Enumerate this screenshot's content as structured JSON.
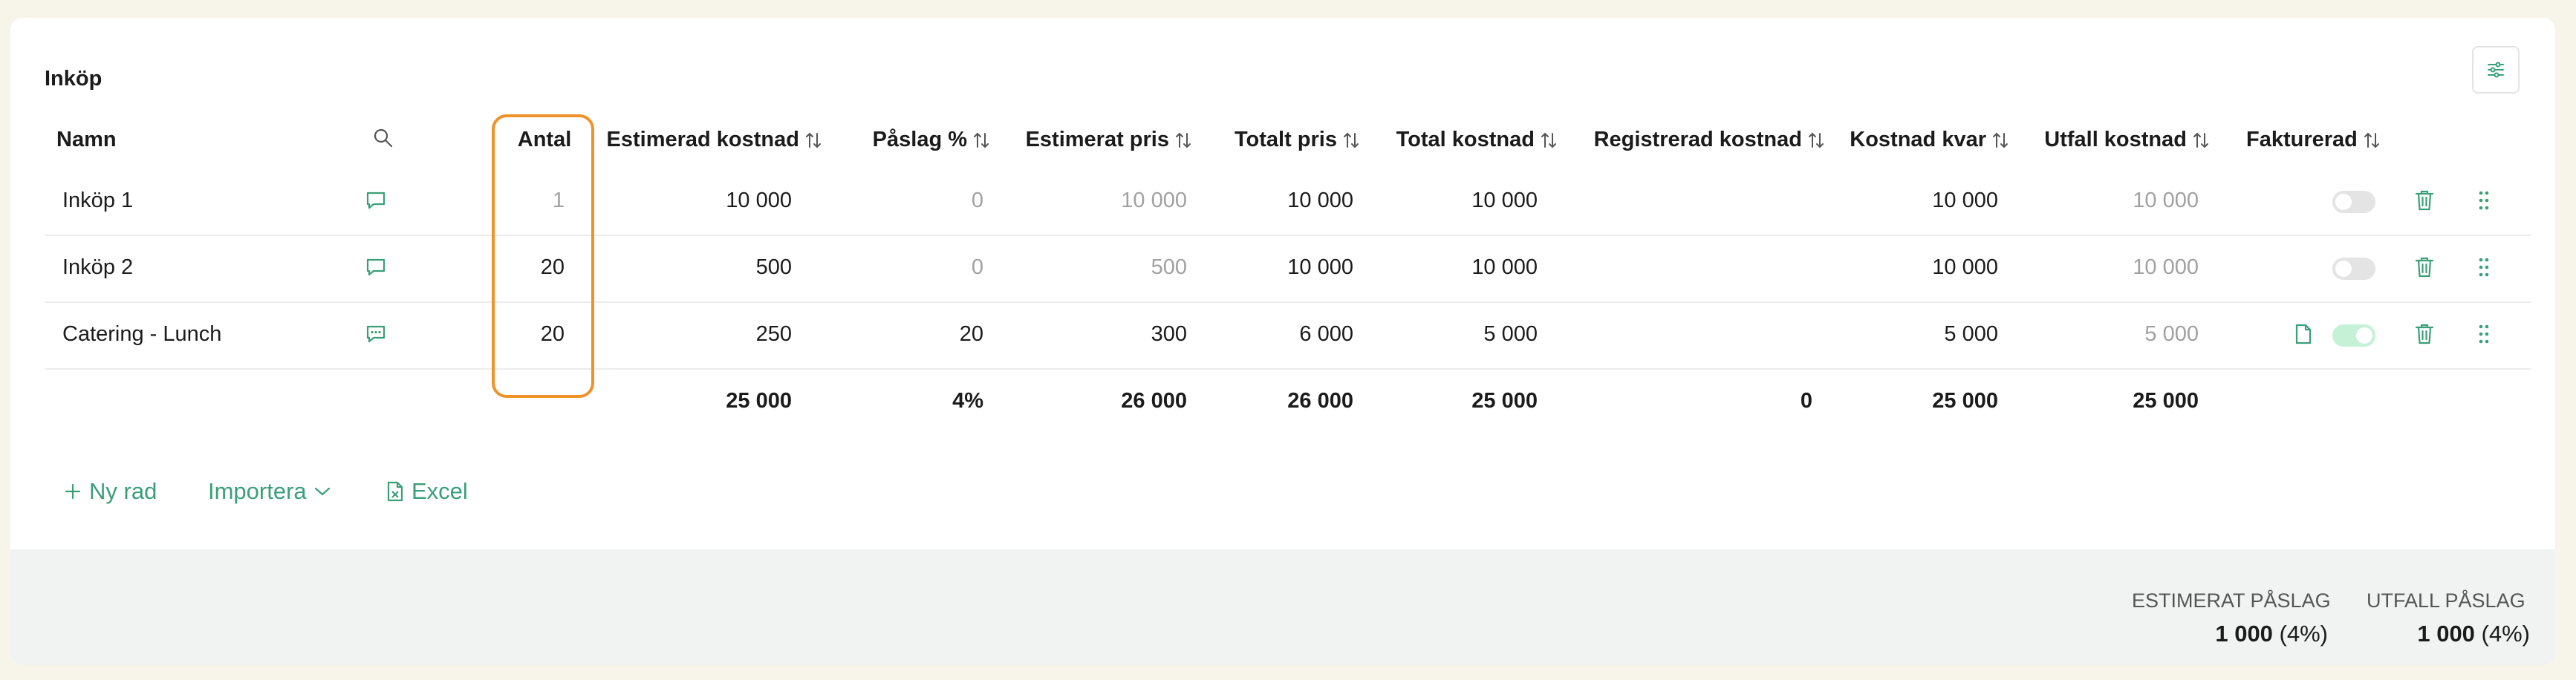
{
  "section": {
    "title": "Inköp"
  },
  "columns": {
    "name": "Namn",
    "qty": "Antal",
    "est_cost": "Estimerad kostnad",
    "markup": "Påslag %",
    "est_price": "Estimerat pris",
    "total_price": "Totalt pris",
    "total_cost": "Total kostnad",
    "reg_cost": "Registrerad kostnad",
    "cost_left": "Kostnad kvar",
    "outcome_cost": "Utfall kostnad",
    "invoiced": "Fakturerad"
  },
  "rows": [
    {
      "name": "Inköp 1",
      "qty": "1",
      "est_cost": "10 000",
      "markup": "0",
      "est_price": "10 000",
      "total_price": "10 000",
      "total_cost": "10 000",
      "reg_cost": "",
      "cost_left": "10 000",
      "outcome_cost": "10 000",
      "invoiced": false
    },
    {
      "name": "Inköp 2",
      "qty": "20",
      "est_cost": "500",
      "markup": "0",
      "est_price": "500",
      "total_price": "10 000",
      "total_cost": "10 000",
      "reg_cost": "",
      "cost_left": "10 000",
      "outcome_cost": "10 000",
      "invoiced": false
    },
    {
      "name": "Catering - Lunch",
      "qty": "20",
      "est_cost": "250",
      "markup": "20",
      "est_price": "300",
      "total_price": "6 000",
      "total_cost": "5 000",
      "reg_cost": "",
      "cost_left": "5 000",
      "outcome_cost": "5 000",
      "invoiced": true
    }
  ],
  "totals": {
    "est_cost": "25 000",
    "markup": "4%",
    "est_price": "26 000",
    "total_price": "26 000",
    "total_cost": "25 000",
    "reg_cost": "0",
    "cost_left": "25 000",
    "outcome_cost": "25 000"
  },
  "actions": {
    "new_row": "Ny rad",
    "import": "Importera",
    "excel": "Excel"
  },
  "summary": {
    "est_markup_label": "ESTIMERAT PÅSLAG",
    "est_markup_value": "1 000",
    "est_markup_pct": "(4%)",
    "outcome_markup_label": "UTFALL PÅSLAG",
    "outcome_markup_value": "1 000",
    "outcome_markup_pct": "(4%)"
  },
  "colors": {
    "accent": "#3a9f79",
    "highlight": "#f0922a",
    "muted": "#a1a1a1"
  }
}
